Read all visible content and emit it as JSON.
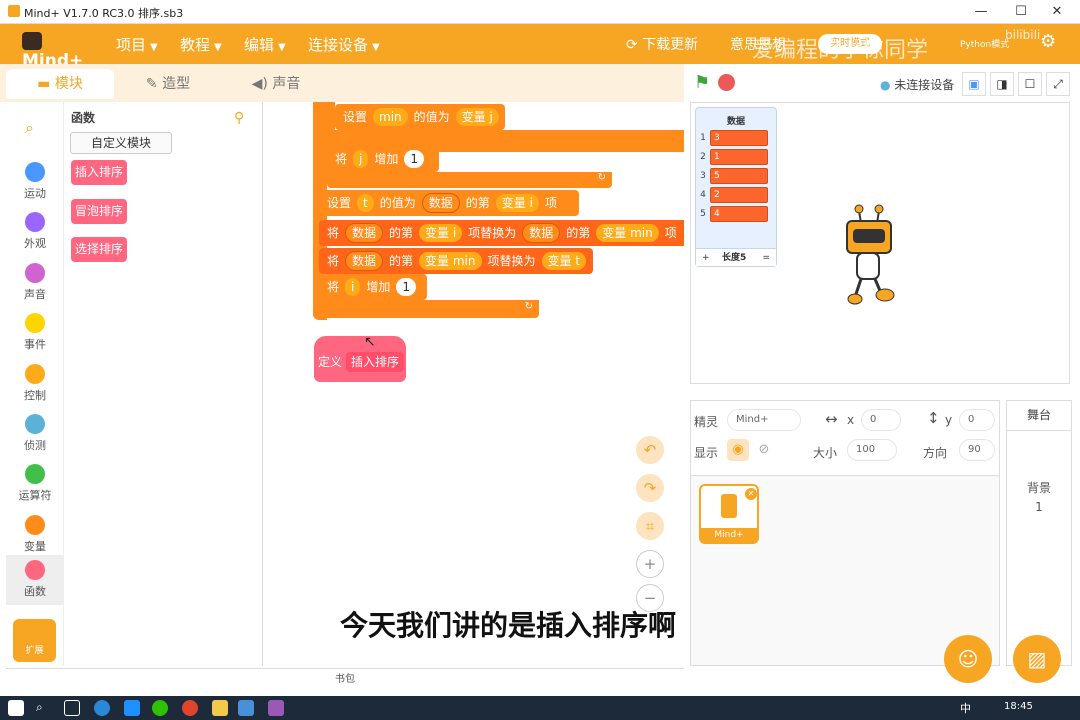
{
  "window": {
    "title": "Mind+ V1.7.0 RC3.0   排序.sb3",
    "minimize": "—",
    "maximize": "☐",
    "close": "✕"
  },
  "menubar": {
    "logo": "Mind+",
    "items": [
      "项目",
      "教程",
      "编辑",
      "连接设备"
    ],
    "download": "下载更新",
    "mode_partial": "意思思想",
    "mode_badge": "实时模式",
    "python_label": "Python模式",
    "watermark": "爱编程的小栋同学",
    "bili": "bilibili"
  },
  "tabs": [
    "模块",
    "造型",
    "声音"
  ],
  "categories": [
    {
      "label": "运动",
      "color": "#4c97ff"
    },
    {
      "label": "外观",
      "color": "#9966ff"
    },
    {
      "label": "声音",
      "color": "#cf63cf"
    },
    {
      "label": "事件",
      "color": "#ffd500"
    },
    {
      "label": "控制",
      "color": "#ffab19"
    },
    {
      "label": "侦测",
      "color": "#5cb1d6"
    },
    {
      "label": "运算符",
      "color": "#40bf4a"
    },
    {
      "label": "变量",
      "color": "#ff8c1a"
    },
    {
      "label": "函数",
      "color": "#ff6680"
    }
  ],
  "extension_label": "扩展",
  "palette": {
    "title": "函数",
    "custom_button": "自定义模块",
    "blocks": [
      "插入排序",
      "冒泡排序",
      "选择排序"
    ]
  },
  "script": {
    "b1": {
      "a": "设置",
      "v": "min",
      "b": "的值为",
      "c": "变量 j"
    },
    "b2": {
      "a": "将",
      "v": "j",
      "b": "增加",
      "n": "1"
    },
    "b3": {
      "a": "设置",
      "v": "t",
      "b": "的值为",
      "l": "数据",
      "c": "的第",
      "d": "变量 i",
      "e": "项"
    },
    "b4": {
      "a": "将",
      "l": "数据",
      "c": "的第",
      "d": "变量 i",
      "e": "项替换为",
      "l2": "数据",
      "c2": "的第",
      "d2": "变量 min",
      "e2": "项"
    },
    "b5": {
      "a": "将",
      "l": "数据",
      "c": "的第",
      "d": "变量 min",
      "e": "项替换为",
      "d2": "变量 t"
    },
    "b6": {
      "a": "将",
      "v": "i",
      "b": "增加",
      "n": "1"
    },
    "def_label": "定义",
    "def_name": "插入排序"
  },
  "bag_label": "书包",
  "stage": {
    "status": "未连接设备",
    "list": {
      "title": "数据",
      "items": [
        "3",
        "1",
        "5",
        "2",
        "4"
      ],
      "footer_add": "+",
      "footer_len": "长度5",
      "footer_eq": "="
    }
  },
  "sprite": {
    "sprite_label": "精灵",
    "name": "Mind+",
    "x_label": "x",
    "x": "0",
    "y_label": "y",
    "y": "0",
    "show_label": "显示",
    "size_label": "大小",
    "size": "100",
    "dir_label": "方向",
    "dir": "90",
    "card_name": "Mind+"
  },
  "stagepane": {
    "title": "舞台",
    "backdrop_label": "背景",
    "backdrop_count": "1"
  },
  "subtitle": "今天我们讲的是插入排序啊",
  "taskbar": {
    "time": "18:45",
    "lang": "中"
  }
}
